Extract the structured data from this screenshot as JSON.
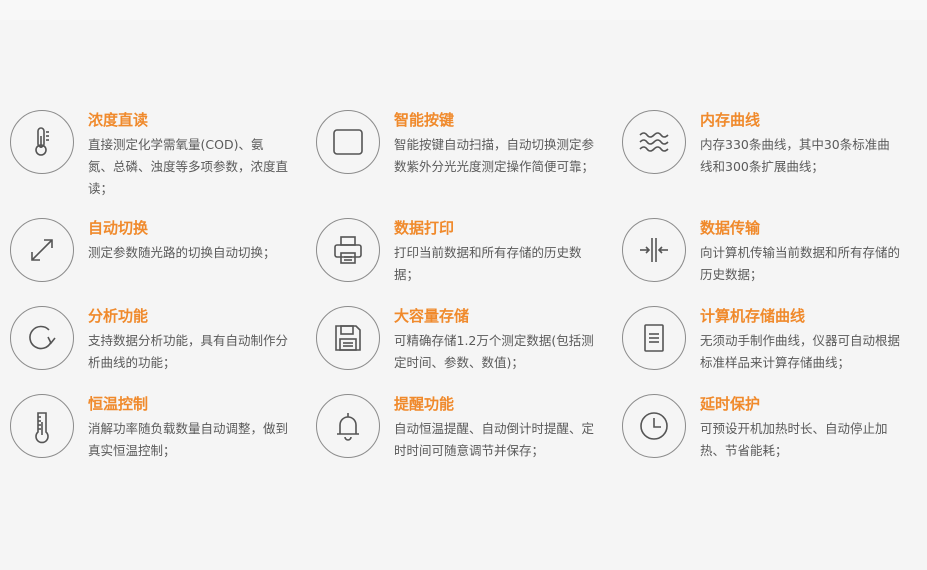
{
  "features": [
    {
      "icon": "thermometer-icon",
      "title": "浓度直读",
      "desc": "直接测定化学需氧量(COD)、氨氮、总磷、浊度等多项参数，浓度直读；"
    },
    {
      "icon": "button-icon",
      "title": "智能按键",
      "desc": "智能按键自动扫描，自动切换测定参数紫外分光光度测定操作简便可靠；"
    },
    {
      "icon": "waves-icon",
      "title": "内存曲线",
      "desc": "内存330条曲线，其中30条标准曲线和300条扩展曲线；"
    },
    {
      "icon": "expand-arrows-icon",
      "title": "自动切换",
      "desc": "测定参数随光路的切换自动切换；"
    },
    {
      "icon": "printer-icon",
      "title": "数据打印",
      "desc": "打印当前数据和所有存储的历史数据；"
    },
    {
      "icon": "transfer-icon",
      "title": "数据传输",
      "desc": "向计算机传输当前数据和所有存储的历史数据；"
    },
    {
      "icon": "refresh-icon",
      "title": "分析功能",
      "desc": "支持数据分析功能，具有自动制作分析曲线的功能；"
    },
    {
      "icon": "floppy-disk-icon",
      "title": "大容量存储",
      "desc": "可精确存储1.2万个测定数据(包括测定时间、参数、数值)；"
    },
    {
      "icon": "document-icon",
      "title": "计算机存储曲线",
      "desc": "无须动手制作曲线，仪器可自动根据标准样品来计算存储曲线；"
    },
    {
      "icon": "thermometer-scale-icon",
      "title": "恒温控制",
      "desc": "消解功率随负载数量自动调整，做到真实恒温控制；"
    },
    {
      "icon": "bell-icon",
      "title": "提醒功能",
      "desc": "自动恒温提醒、自动倒计时提醒、定时时间可随意调节并保存；"
    },
    {
      "icon": "clock-icon",
      "title": "延时保护",
      "desc": "可预设开机加热时长、自动停止加热、节省能耗；"
    }
  ]
}
